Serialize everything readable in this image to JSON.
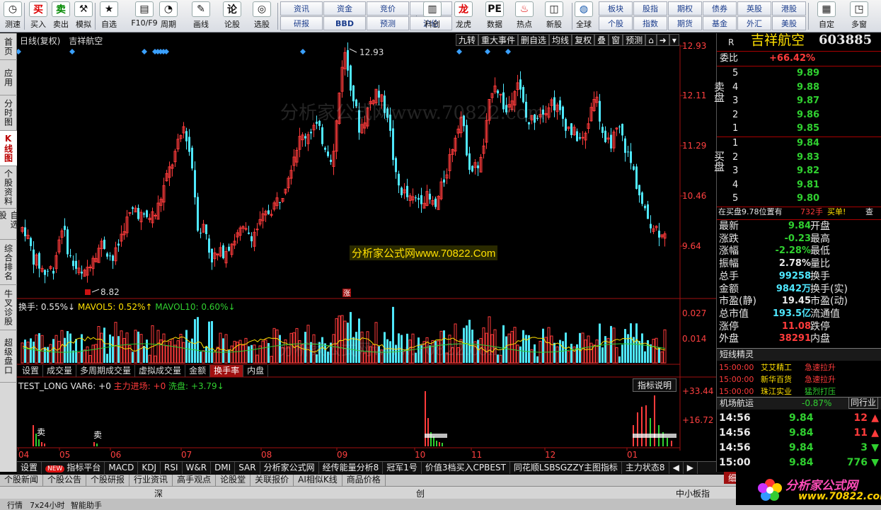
{
  "toolbar": {
    "buttons": [
      {
        "label": "测速",
        "icon": "clock-icon"
      },
      {
        "label": "买入",
        "icon": "buy-icon"
      },
      {
        "label": "卖出",
        "icon": "sell-icon"
      },
      {
        "label": "模拟",
        "icon": "hammer-icon"
      },
      {
        "label": "自选",
        "icon": "star-icon"
      },
      {
        "label": "F10/F9",
        "icon": "f10-icon"
      },
      {
        "label": "周期",
        "icon": "period-icon"
      },
      {
        "label": "画线",
        "icon": "pen-icon"
      },
      {
        "label": "论股",
        "icon": "discuss-icon"
      },
      {
        "label": "选股",
        "icon": "select-icon"
      }
    ],
    "grid1": [
      "资讯",
      "资金",
      "竞价",
      "陆港",
      "研报",
      "BBD",
      "预测",
      "沪伦"
    ],
    "icons2": [
      {
        "label": "科创",
        "icon": "chart-icon"
      },
      {
        "label": "龙虎",
        "icon": "dragon-icon"
      },
      {
        "label": "数据",
        "icon": "pe-icon"
      },
      {
        "label": "热点",
        "icon": "fire-icon"
      },
      {
        "label": "新股",
        "icon": "newstock-icon"
      },
      {
        "label": "全球",
        "icon": "globe-icon"
      }
    ],
    "grid2": [
      "板块",
      "股指",
      "期权",
      "债券",
      "英股",
      "港股",
      "个股",
      "指数",
      "期货",
      "基金",
      "外汇",
      "美股"
    ],
    "right": [
      {
        "label": "自定",
        "icon": "custom-icon"
      },
      {
        "label": "多窗",
        "icon": "windows-icon"
      }
    ]
  },
  "left_tabs": [
    "首页",
    "应用",
    "分时图",
    "K线图",
    "个股资料",
    "自选股",
    "综合排名",
    "牛叉诊股",
    "超级盘口"
  ],
  "left_tab_active": 3,
  "chart": {
    "title_left": [
      "日线(复权)",
      "吉祥航空"
    ],
    "buttons": [
      "九转",
      "重大事件",
      "删自选",
      "均线",
      "复权",
      "叠",
      "窗",
      "预测"
    ],
    "price_axis": [
      "12.93",
      "12.11",
      "11.29",
      "10.46",
      "9.64"
    ],
    "high_label": "12.93",
    "low_label": "8.82",
    "zhang_label": "涨",
    "watermark_center": "分析家公式网www.70822.Com",
    "watermark_faded": "分析家公式网www.70822.com",
    "vol_header": {
      "a": "换手: 0.55%↓",
      "b": "MAVOL5: 0.52%↑",
      "c": "MAVOL10: 0.60%↓"
    },
    "vol_axis": [
      "0.027",
      "0.014"
    ],
    "vol_tabs": [
      "设置",
      "成交量",
      "多周期成交量",
      "虚拟成交量",
      "金额",
      "换手率",
      "内盘"
    ],
    "vol_tab_active": 5,
    "ind_header": {
      "a": "TEST_LONG VAR6: +0",
      "b": "主力进场: +0",
      "c": "洗盘: +3.79↓"
    },
    "ind_button": "指标说明",
    "ind_axis": [
      "+33.44",
      "+16.72"
    ],
    "sell_label": "卖",
    "months": [
      "04",
      "05",
      "06",
      "07",
      "08",
      "09",
      "10",
      "11",
      "12",
      "01"
    ]
  },
  "bottom_tabs": [
    "设置",
    "指标平台",
    "MACD",
    "KDJ",
    "RSI",
    "W&R",
    "DMI",
    "SAR",
    "分析家公式网",
    "经传能量分析8",
    "冠军1号",
    "价值3档买入CPBEST",
    "同花顺LSBSGZZY主图指标",
    "主力状态8"
  ],
  "new_badge": "NEW",
  "news_bar": [
    "个股新闻",
    "个股公告",
    "个股研报",
    "行业资讯",
    "高手观点",
    "论股堂",
    "关联报价",
    "AI相似K线",
    "商品价格"
  ],
  "idx_bar": {
    "a": "深",
    "b": "创",
    "c": "中小板指"
  },
  "status_bar": {
    "a": "行情",
    "b": "7x24小时",
    "c": "智能助手",
    "d": "细"
  },
  "quote": {
    "r": "R",
    "name": "吉祥航空",
    "code": "603885",
    "weibi_label": "委比",
    "weibi": "+66.42%",
    "sell_label": "卖盘",
    "buy_label": "买盘",
    "asks": [
      {
        "n": "5",
        "p": "9.89"
      },
      {
        "n": "4",
        "p": "9.88"
      },
      {
        "n": "3",
        "p": "9.87"
      },
      {
        "n": "2",
        "p": "9.86"
      },
      {
        "n": "1",
        "p": "9.85"
      }
    ],
    "bids": [
      {
        "n": "1",
        "p": "9.84"
      },
      {
        "n": "2",
        "p": "9.83"
      },
      {
        "n": "3",
        "p": "9.82"
      },
      {
        "n": "4",
        "p": "9.81"
      },
      {
        "n": "5",
        "p": "9.80"
      }
    ],
    "notice_a": "在买盘9.78位置有",
    "notice_b": "732手",
    "notice_c": "买单!",
    "notice_d": "查",
    "stats": [
      {
        "l": "最新",
        "v": "9.84",
        "c": "green",
        "l2": "开盘"
      },
      {
        "l": "涨跌",
        "v": "-0.23",
        "c": "green",
        "l2": "最高"
      },
      {
        "l": "涨幅",
        "v": "-2.28%",
        "c": "green",
        "l2": "最低"
      },
      {
        "l": "振幅",
        "v": "2.78%",
        "c": "white",
        "l2": "量比"
      },
      {
        "l": "总手",
        "v": "99258",
        "c": "cyan",
        "l2": "换手"
      },
      {
        "l": "金额",
        "v": "9842万",
        "c": "cyan",
        "l2": "换手(实)"
      },
      {
        "l": "市盈(静)",
        "v": "19.45",
        "c": "white",
        "l2": "市盈(动)"
      },
      {
        "l": "总市值",
        "v": "193.5亿",
        "c": "cyan",
        "l2": "流通值"
      },
      {
        "l": "涨停",
        "v": "11.08",
        "c": "red",
        "l2": "跌停"
      },
      {
        "l": "外盘",
        "v": "38291",
        "c": "red",
        "l2": "内盘"
      }
    ],
    "spirit_title": "短线精灵",
    "spirits": [
      {
        "t": "15:00:00",
        "s": "艾艾精工",
        "e": "急速拉升"
      },
      {
        "t": "15:00:00",
        "s": "新华百货",
        "e": "急速拉升"
      },
      {
        "t": "15:00:00",
        "s": "珠江实业",
        "e": "猛烈打压"
      }
    ],
    "sector_name": "机场航运",
    "sector_pct": "-0.87%",
    "sector_btn": "同行业",
    "ticks": [
      {
        "t": "14:56",
        "p": "9.84",
        "v": "12",
        "d": "up"
      },
      {
        "t": "14:56",
        "p": "9.84",
        "v": "11",
        "d": "up"
      },
      {
        "t": "14:56",
        "p": "9.84",
        "v": "3",
        "d": "down"
      },
      {
        "t": "15:00",
        "p": "9.84",
        "v": "776",
        "d": "down"
      }
    ]
  },
  "logo_text": "分析家公式网",
  "logo_url": "www.70822.com",
  "colors": {
    "up": "#ff3b3b",
    "down": "#4fe8ff",
    "accent": "#a01010"
  }
}
